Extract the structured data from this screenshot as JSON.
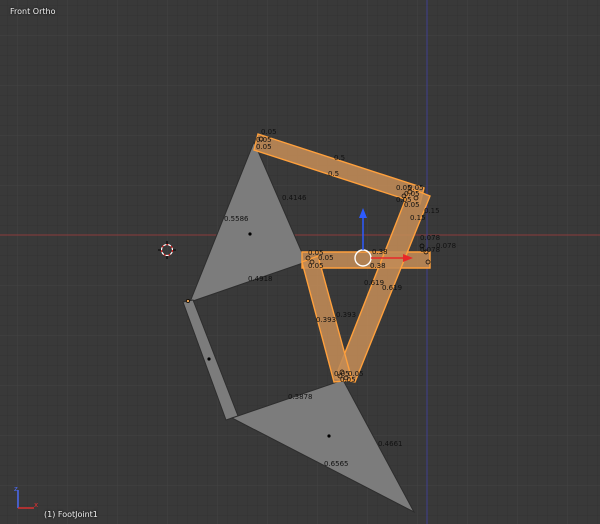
{
  "viewport": {
    "view_label": "Front Ortho",
    "object_label": "(1) FootJoint1"
  },
  "colors": {
    "background": "#393939",
    "grid_minor": "#323232",
    "grid_major": "#424242",
    "x_axis": "#8a3b3b",
    "z_axis": "#3b3b8a",
    "mesh_gray": "#7c7c7c",
    "mesh_edge": "#2d2d2d",
    "selected_fill": "#c18b56",
    "selected_edge": "#ffa03c",
    "label_text": "#111111"
  },
  "labels": {
    "top_left": [
      "0.05",
      "0.05",
      "0.05"
    ],
    "top_middle": [
      "0.5",
      "0.5"
    ],
    "right_cluster": [
      "0.05",
      "0.05",
      "0.05",
      "0.05",
      "0.05"
    ],
    "right_side": [
      "0.15",
      "0.15",
      "0.078",
      "0.078",
      "0.078"
    ],
    "center_cluster": [
      "0.05",
      "0.05",
      "0.05",
      "0.38",
      "0.38"
    ],
    "diag": [
      "0.619",
      "0.619",
      "0.393",
      "0.393"
    ],
    "bottom_cluster": [
      "0.05",
      "0.05",
      "0.05"
    ],
    "gray_triangle": [
      "0.5586",
      "0.4146",
      "0.4918"
    ],
    "foot": [
      "0.3878",
      "0.4661",
      "0.6565"
    ]
  },
  "icons": {
    "cursor": "3d-cursor-icon",
    "gizmo": "transform-gizmo-icon",
    "axes": "view-axes-icon"
  }
}
